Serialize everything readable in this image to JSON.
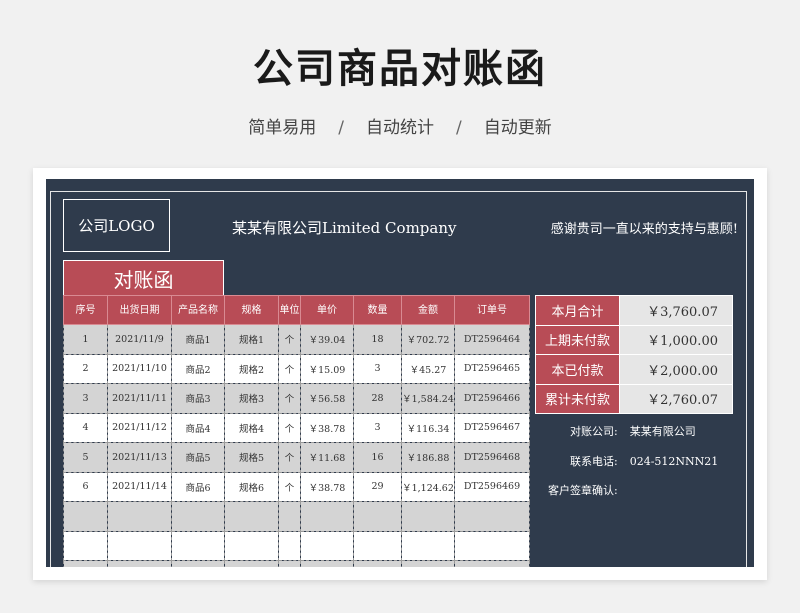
{
  "header": {
    "title": "公司商品对账函",
    "subtitle_items": [
      "简单易用",
      "自动统计",
      "自动更新"
    ],
    "separator": "/"
  },
  "sheet": {
    "logo": "公司LOGO",
    "company": "某某有限公司Limited Company",
    "thanks": "感谢贵司一直以来的支持与惠顾!",
    "doc_title": "对账函",
    "columns": [
      "序号",
      "出货日期",
      "产品名称",
      "规格",
      "单位",
      "单价",
      "数量",
      "金额",
      "订单号"
    ],
    "rows": [
      [
        "1",
        "2021/11/9",
        "商品1",
        "规格1",
        "个",
        "￥39.04",
        "18",
        "￥702.72",
        "DT2596464"
      ],
      [
        "2",
        "2021/11/10",
        "商品2",
        "规格2",
        "个",
        "￥15.09",
        "3",
        "￥45.27",
        "DT2596465"
      ],
      [
        "3",
        "2021/11/11",
        "商品3",
        "规格3",
        "个",
        "￥56.58",
        "28",
        "￥1,584.24",
        "DT2596466"
      ],
      [
        "4",
        "2021/11/12",
        "商品4",
        "规格4",
        "个",
        "￥38.78",
        "3",
        "￥116.34",
        "DT2596467"
      ],
      [
        "5",
        "2021/11/13",
        "商品5",
        "规格5",
        "个",
        "￥11.68",
        "16",
        "￥186.88",
        "DT2596468"
      ],
      [
        "6",
        "2021/11/14",
        "商品6",
        "规格6",
        "个",
        "￥38.78",
        "29",
        "￥1,124.62",
        "DT2596469"
      ],
      [
        "",
        "",
        "",
        "",
        "",
        "",
        "",
        "",
        ""
      ],
      [
        "",
        "",
        "",
        "",
        "",
        "",
        "",
        "",
        ""
      ],
      [
        "",
        "",
        "",
        "",
        "",
        "",
        "",
        "",
        ""
      ]
    ],
    "summary": [
      {
        "label": "本月合计",
        "value": "￥3,760.07"
      },
      {
        "label": "上期未付款",
        "value": "￥1,000.00"
      },
      {
        "label": "本已付款",
        "value": "￥2,000.00"
      },
      {
        "label": "累计未付款",
        "value": "￥2,760.07"
      }
    ],
    "contact": {
      "company_label": "对账公司:",
      "company_value": "某某有限公司",
      "phone_label": "联系电话:",
      "phone_value": "024-512NNN21",
      "sign_label": "客户签章确认:"
    }
  }
}
